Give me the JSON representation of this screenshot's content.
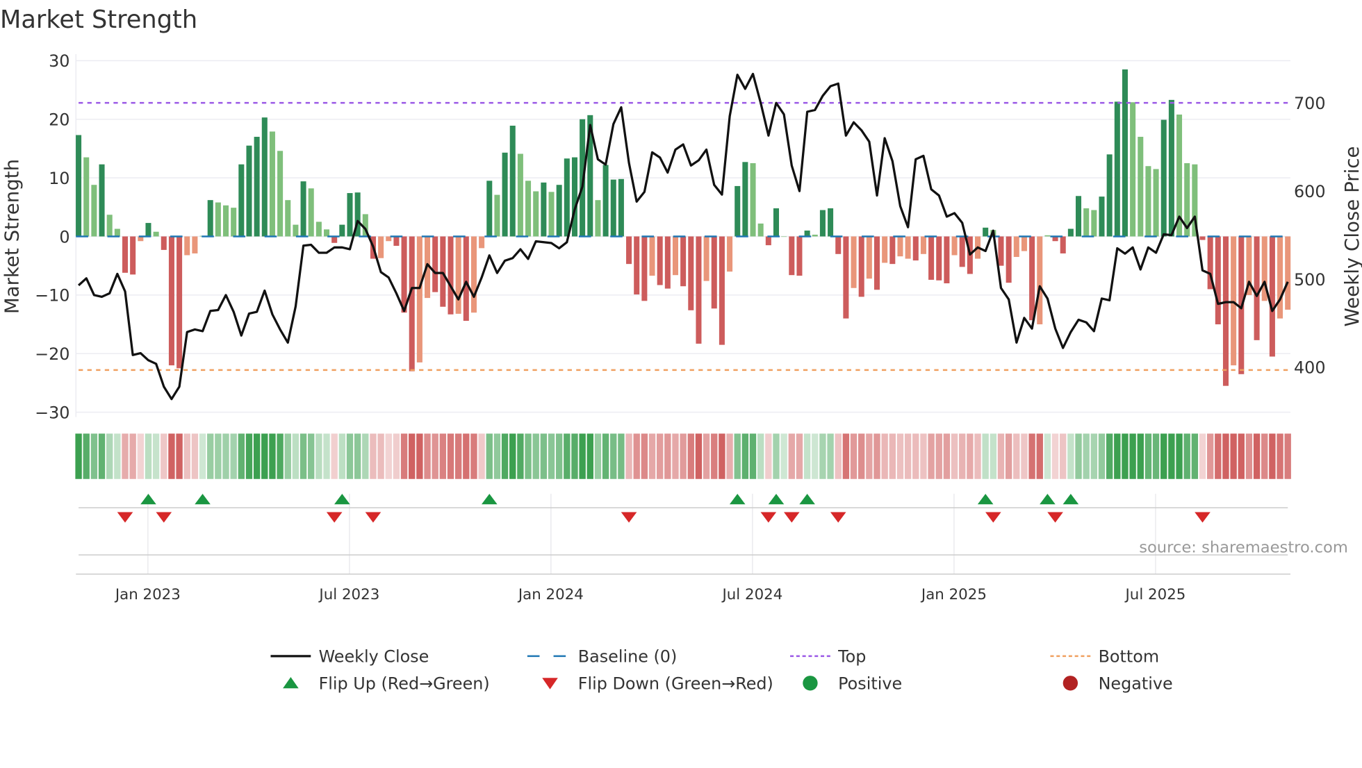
{
  "chart_data": {
    "type": "bar",
    "title": "Market Strength",
    "ylabel": "Market Strength",
    "y2label": "Weekly Close Price",
    "ylim": [
      -30,
      30
    ],
    "y2lim": [
      340,
      740
    ],
    "yticks": [
      "30",
      "20",
      "10",
      "0",
      "−10",
      "−20",
      "−30"
    ],
    "ytick_values": [
      30,
      20,
      10,
      0,
      -10,
      -20,
      -30
    ],
    "y2ticks": [
      "700",
      "600",
      "500",
      "400"
    ],
    "y2tick_values": [
      700,
      600,
      500,
      400
    ],
    "xticks": [
      "Jan 2023",
      "Jul 2023",
      "Jan 2024",
      "Jul 2024",
      "Jan 2025",
      "Jul 2025"
    ],
    "xtick_week_index": [
      9,
      35,
      61,
      87,
      113,
      139
    ],
    "top_level": 22.8,
    "bottom_level": -22.8,
    "strength": [
      17.3,
      13.5,
      8.8,
      12.3,
      3.7,
      1.3,
      -6.2,
      -6.5,
      -0.8,
      2.3,
      0.8,
      -2.3,
      -22,
      -22.5,
      -3.2,
      -2.9,
      0.1,
      6.2,
      5.8,
      5.3,
      4.9,
      12.3,
      15.5,
      17,
      20.3,
      17.9,
      14.6,
      6.2,
      2,
      9.4,
      8.2,
      2.5,
      1.2,
      -1.1,
      2,
      7.4,
      7.5,
      3.8,
      -3.8,
      -3.7,
      -0.8,
      -1.6,
      -13,
      -23,
      -21.5,
      -10.5,
      -9.5,
      -12,
      -13.3,
      -13.2,
      -14.4,
      -13,
      -2,
      9.5,
      7.1,
      14.3,
      18.9,
      14.1,
      9.5,
      7.7,
      9.2,
      7.6,
      8.8,
      13.3,
      13.5,
      20,
      20.7,
      6.2,
      12.2,
      9.7,
      9.8,
      -4.7,
      -9.9,
      -11,
      -6.7,
      -8.3,
      -8.9,
      -6.6,
      -8.5,
      -12.6,
      -18.3,
      -7.6,
      -12.3,
      -18.5,
      -6,
      8.6,
      12.7,
      12.5,
      2.2,
      -1.5,
      4.8,
      0,
      -6.6,
      -6.7,
      1,
      0.3,
      4.5,
      4.8,
      -3,
      -14,
      -8.8,
      -10.3,
      -7.2,
      -9.1,
      -4.5,
      -4.7,
      -3.4,
      -3.8,
      -4.1,
      -3,
      -7.4,
      -7.5,
      -8,
      -3.2,
      -5.2,
      -6.4,
      -3.8,
      1.5,
      1.1,
      -5,
      -7.9,
      -3.5,
      -2.5,
      -14.3,
      -15,
      0.2,
      -0.8,
      -2.9,
      1.3,
      6.9,
      4.8,
      4.5,
      6.8,
      14,
      23,
      28.5,
      22.9,
      17,
      12,
      11.5,
      19.9,
      23.3,
      20.8,
      12.5,
      12.3,
      -0.6,
      -9,
      -15,
      -25.5,
      -22,
      -23.5,
      -10,
      -17.7,
      -11,
      -20.5,
      -14,
      -12.5
    ],
    "strong": [
      1,
      0,
      0,
      1,
      0,
      0,
      1,
      1,
      0,
      1,
      0,
      1,
      1,
      1,
      0,
      0,
      0,
      1,
      0,
      0,
      0,
      1,
      1,
      1,
      1,
      0,
      0,
      0,
      0,
      1,
      0,
      0,
      0,
      1,
      1,
      1,
      1,
      0,
      1,
      0,
      0,
      1,
      1,
      1,
      0,
      0,
      1,
      1,
      1,
      0,
      1,
      0,
      0,
      1,
      0,
      1,
      1,
      0,
      0,
      0,
      1,
      0,
      1,
      1,
      1,
      1,
      1,
      0,
      1,
      1,
      1,
      1,
      1,
      1,
      0,
      1,
      1,
      0,
      1,
      1,
      1,
      0,
      1,
      1,
      0,
      1,
      1,
      0,
      0,
      1,
      1,
      0,
      1,
      1,
      1,
      0,
      1,
      1,
      1,
      1,
      0,
      1,
      0,
      1,
      0,
      1,
      0,
      0,
      1,
      0,
      1,
      1,
      1,
      0,
      1,
      1,
      0,
      1,
      0,
      1,
      1,
      0,
      0,
      1,
      0,
      0,
      1,
      1,
      1,
      1,
      0,
      0,
      1,
      1,
      1,
      1,
      0,
      0,
      0,
      0,
      1,
      1,
      0,
      0,
      0,
      1,
      1,
      1,
      1,
      0,
      1,
      0,
      1,
      0,
      1,
      0,
      0
    ],
    "weekly_close": [
      493,
      501,
      482,
      480,
      484,
      506,
      486,
      414,
      416,
      408,
      404,
      378,
      364,
      378,
      440,
      443,
      441,
      464,
      465,
      482,
      463,
      436,
      461,
      463,
      487,
      460,
      443,
      428,
      469,
      538,
      539,
      530,
      530,
      536,
      536,
      534,
      566,
      557,
      537,
      508,
      502,
      484,
      464,
      490,
      490,
      517,
      507,
      507,
      492,
      477,
      497,
      480,
      502,
      527,
      507,
      521,
      524,
      534,
      523,
      543,
      542,
      541,
      535,
      542,
      579,
      605,
      675,
      636,
      630,
      676,
      695,
      632,
      588,
      599,
      644,
      638,
      621,
      647,
      653,
      629,
      635,
      647,
      607,
      596,
      685,
      732,
      716,
      733,
      700,
      663,
      700,
      687,
      629,
      600,
      690,
      692,
      708,
      719,
      722,
      663,
      678,
      669,
      656,
      595,
      660,
      634,
      583,
      559,
      636,
      640,
      602,
      595,
      571,
      575,
      564,
      528,
      536,
      532,
      555,
      490,
      477,
      428,
      456,
      444,
      492,
      478,
      444,
      422,
      440,
      454,
      451,
      441,
      478,
      476,
      535,
      529,
      536,
      511,
      536,
      530,
      551,
      550,
      571,
      558,
      571,
      510,
      506,
      472,
      474,
      474,
      467,
      497,
      481,
      497,
      464,
      477,
      497
    ],
    "flip_up_week_index": [
      9,
      16,
      34,
      53,
      85,
      90,
      94,
      117,
      125,
      128
    ],
    "flip_down_week_index": [
      6,
      11,
      33,
      38,
      71,
      89,
      92,
      98,
      118,
      126,
      145
    ],
    "source": "source: sharemaestro.com",
    "legend": [
      {
        "label": "Weekly Close",
        "kind": "line"
      },
      {
        "label": "Baseline (0)",
        "kind": "dash"
      },
      {
        "label": "Top",
        "kind": "dot"
      },
      {
        "label": "Bottom",
        "kind": "dot2"
      },
      {
        "label": "Flip Up (Red→Green)",
        "kind": "up"
      },
      {
        "label": "Flip Down (Green→Red)",
        "kind": "down"
      },
      {
        "label": "Positive",
        "kind": "pos"
      },
      {
        "label": "Negative",
        "kind": "neg"
      }
    ],
    "colors": {
      "strong_pos": "#2e8b57",
      "weak_pos": "#7fbf7b",
      "strong_neg": "#cd5c5c",
      "weak_neg": "#e9967a",
      "close": "#111111",
      "baseline": "#1f77b4",
      "top": "#9b59e6",
      "bottom": "#f0a060",
      "flip_up": "#1a9641",
      "flip_down": "#d62728",
      "positive": "#1a9641",
      "negative": "#b22222"
    },
    "legend_placement": "bottom"
  }
}
